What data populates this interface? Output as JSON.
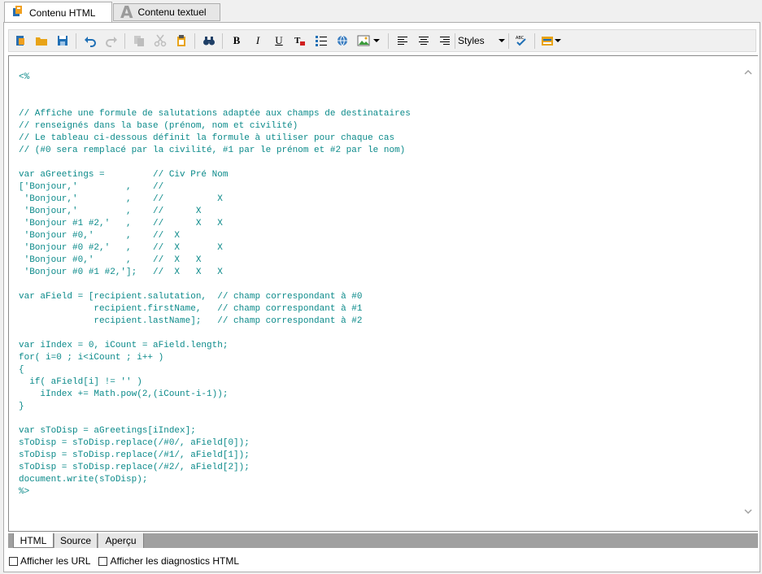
{
  "tabs": [
    {
      "label": "Contenu HTML",
      "active": true
    },
    {
      "label": "Contenu textuel",
      "active": false
    }
  ],
  "toolbar": {
    "styles_label": "Styles"
  },
  "editor": {
    "content": "<%\n\n\n// Affiche une formule de salutations adaptée aux champs de destinataires\n// renseignés dans la base (prénom, nom et civilité)\n// Le tableau ci-dessous définit la formule à utiliser pour chaque cas\n// (#0 sera remplacé par la civilité, #1 par le prénom et #2 par le nom)\n\nvar aGreetings =         // Civ Pré Nom\n['Bonjour,'         ,    //\n 'Bonjour,'         ,    //          X\n 'Bonjour,'         ,    //      X\n 'Bonjour #1 #2,'   ,    //      X   X\n 'Bonjour #0,'      ,    //  X\n 'Bonjour #0 #2,'   ,    //  X       X\n 'Bonjour #0,'      ,    //  X   X\n 'Bonjour #0 #1 #2,'];   //  X   X   X\n\nvar aField = [recipient.salutation,  // champ correspondant à #0\n              recipient.firstName,   // champ correspondant à #1\n              recipient.lastName];   // champ correspondant à #2\n\nvar iIndex = 0, iCount = aField.length;\nfor( i=0 ; i<iCount ; i++ )\n{\n  if( aField[i] != '' )\n    iIndex += Math.pow(2,(iCount-i-1));\n}\n\nvar sToDisp = aGreetings[iIndex];\nsToDisp = sToDisp.replace(/#0/, aField[0]);\nsToDisp = sToDisp.replace(/#1/, aField[1]);\nsToDisp = sToDisp.replace(/#2/, aField[2]);\ndocument.write(sToDisp);\n%>"
  },
  "bottom_tabs": [
    {
      "label": "HTML",
      "active": true
    },
    {
      "label": "Source",
      "active": false
    },
    {
      "label": "Aperçu",
      "active": false
    }
  ],
  "options": {
    "show_urls": "Afficher les URL",
    "show_diagnostics": "Afficher les diagnostics HTML"
  }
}
